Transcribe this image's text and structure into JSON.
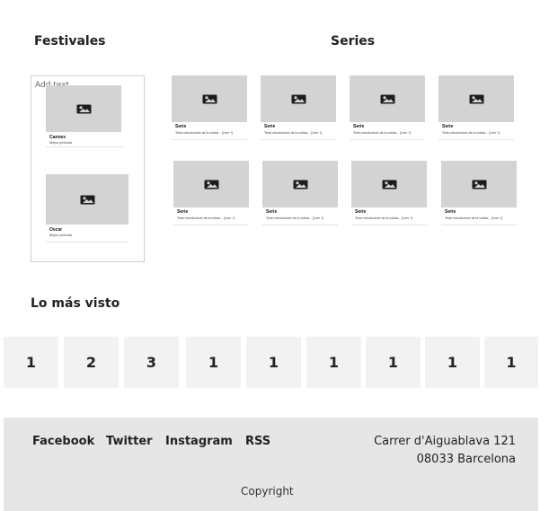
{
  "festivales": {
    "heading": "Festivales",
    "add_text": "Add text",
    "items": [
      {
        "title": "Cannes",
        "desc": "Mejor película"
      },
      {
        "title": "Oscar",
        "desc": "Mejor película"
      }
    ]
  },
  "series": {
    "heading": "Series",
    "cards": [
      {
        "title": "Serie",
        "desc": "Texto introductorio de la noticia... [Leer +]"
      },
      {
        "title": "Serie",
        "desc": "Texto introductorio de la noticia... [Leer +]"
      },
      {
        "title": "Serie",
        "desc": "Texto introductorio de la noticia... [Leer +]"
      },
      {
        "title": "Serie",
        "desc": "Texto introductorio de la noticia... [Leer +]"
      },
      {
        "title": "Serie",
        "desc": "Texto introductorio de la noticia... [Leer +]"
      },
      {
        "title": "Serie",
        "desc": "Texto introductorio de la noticia... [Leer +]"
      },
      {
        "title": "Serie",
        "desc": "Texto introductorio de la noticia... [Leer +]"
      },
      {
        "title": "Serie",
        "desc": "Texto introductorio de la noticia... [Leer +]"
      }
    ]
  },
  "lo_mas_visto": {
    "heading": "Lo más visto",
    "ranks": [
      "1",
      "2",
      "3",
      "1",
      "1",
      "1",
      "1",
      "1",
      "1"
    ]
  },
  "footer": {
    "links": [
      "Facebook",
      "Twitter",
      "Instagram",
      "RSS"
    ],
    "address_line1": "Carrer d'Aiguablava 121",
    "address_line2": "08033 Barcelona",
    "copyright": "Copyright"
  },
  "icons": {
    "image_placeholder": "image-icon"
  },
  "colors": {
    "placeholder_gray": "#d3d3d3",
    "footer_bg": "#e6e6e6",
    "tile_bg": "#f2f2f2"
  }
}
